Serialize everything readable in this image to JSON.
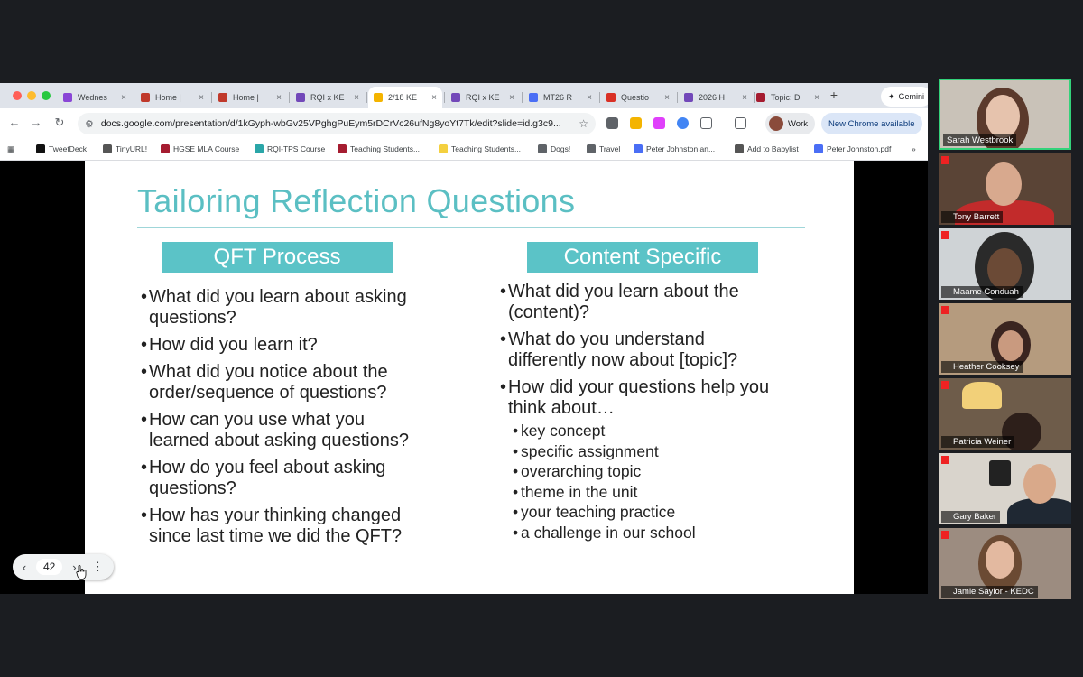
{
  "browser": {
    "tabs": [
      {
        "label": "Wednes",
        "color": "#8a46d6"
      },
      {
        "label": "Home | ",
        "color": "#c0392b"
      },
      {
        "label": "Home | ",
        "color": "#c0392b"
      },
      {
        "label": "RQI x KE",
        "color": "#7248b9"
      },
      {
        "label": "2/18 KE",
        "color": "#f4b400",
        "active": true
      },
      {
        "label": "RQI x KE",
        "color": "#7248b9"
      },
      {
        "label": "MT26 R",
        "color": "#4a6ef5"
      },
      {
        "label": "Questio",
        "color": "#d93025"
      },
      {
        "label": "2026 H",
        "color": "#7248b9"
      },
      {
        "label": "Topic: D",
        "color": "#a51c30"
      }
    ],
    "new_tab_label": "+",
    "gemini_label": "Gemini",
    "url": "docs.google.com/presentation/d/1kGyph-wbGv25VPghgPuEym5rDCrVc26ufNg8yoYt7Tk/edit?slide=id.g3c9...",
    "profile_label": "Work",
    "new_chrome_label": "New Chrome available",
    "bookmarks": [
      {
        "label": "TweetDeck",
        "color": "#111111"
      },
      {
        "label": "TinyURL!",
        "color": "#555555"
      },
      {
        "label": "HGSE MLA Course",
        "color": "#a51c30"
      },
      {
        "label": "RQI-TPS Course",
        "color": "#2aa6a8"
      },
      {
        "label": "Teaching Students...",
        "color": "#a51c30"
      },
      {
        "label": "Teaching Students...",
        "color": "#f4d03f"
      },
      {
        "label": "Dogs!",
        "color": "#5f6368"
      },
      {
        "label": "Travel",
        "color": "#5f6368"
      },
      {
        "label": "Peter Johnston an...",
        "color": "#4a6ef5"
      },
      {
        "label": "Add to Babylist",
        "color": "#555555"
      },
      {
        "label": "Peter Johnston.pdf",
        "color": "#4a6ef5"
      }
    ],
    "more_bookmarks": "»"
  },
  "slide": {
    "title": "Tailoring Reflection Questions",
    "accent_color": "#5bc3c7",
    "left": {
      "heading": "QFT Process",
      "items": [
        [
          "What did you learn about asking",
          "questions?"
        ],
        [
          "How did you learn it?"
        ],
        [
          "What did you notice about the",
          "order/sequence of questions?"
        ],
        [
          "How can you use what you",
          "learned about asking questions?"
        ],
        [
          "How do you feel about asking",
          "questions?"
        ],
        [
          "How has your thinking changed",
          "since last time we did the QFT?"
        ]
      ]
    },
    "right": {
      "heading": "Content Specific",
      "items": [
        [
          "What did you learn about the",
          "(content)?"
        ],
        [
          "What do you understand",
          "differently now about [topic]?"
        ],
        [
          "How did your questions help you",
          "think about…"
        ]
      ],
      "subitems": [
        "key concept",
        "specific assignment",
        "overarching topic",
        "theme in the unit",
        "your teaching practice",
        "a challenge in our school"
      ]
    }
  },
  "slide_nav": {
    "prev": "‹",
    "page": "42",
    "next": "›",
    "more": "⋮"
  },
  "participants": [
    {
      "name": "Sarah Westbrook",
      "speaking": true
    },
    {
      "name": "Tony Barrett"
    },
    {
      "name": "Maame Conduah"
    },
    {
      "name": "Heather Cooksey"
    },
    {
      "name": "Patricia Weiner"
    },
    {
      "name": "Gary Baker"
    },
    {
      "name": "Jamie Saylor - KEDC"
    }
  ]
}
